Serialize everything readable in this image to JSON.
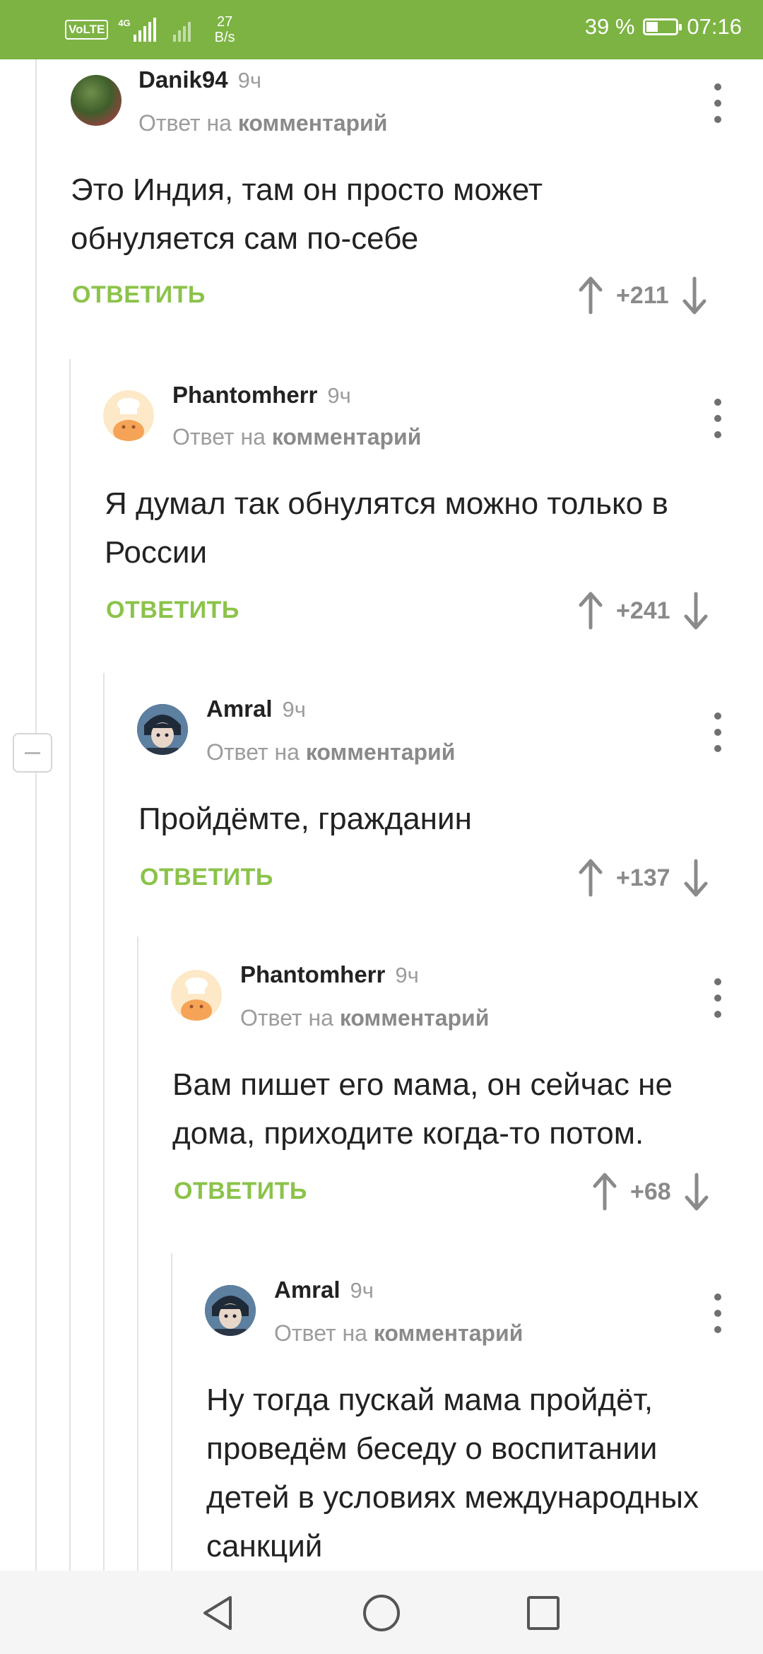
{
  "status_bar": {
    "volte": "VoLTE",
    "network_gen": "4G",
    "speed_value": "27",
    "speed_unit": "B/s",
    "battery_percent": "39 %",
    "battery_level": 0.39,
    "time": "07:16"
  },
  "labels": {
    "reply_to_prefix": "Ответ на",
    "reply_to_target": "комментарий",
    "reply_action": "ОТВЕТИТЬ"
  },
  "comments": [
    {
      "author": "Danik94",
      "time": "9ч",
      "body": "Это Индия, там он просто может обнуляется сам по-себе",
      "score": "+211"
    },
    {
      "author": "Phantomherr",
      "time": "9ч",
      "body": "Я думал так обнулятся можно только в России",
      "score": "+241"
    },
    {
      "author": "Amral",
      "time": "9ч",
      "body": "Пройдёмте, гражданин",
      "score": "+137"
    },
    {
      "author": "Phantomherr",
      "time": "9ч",
      "body": "Вам пишет его мама, он сейчас не дома, приходите когда-то потом.",
      "score": "+68"
    },
    {
      "author": "Amral",
      "time": "9ч",
      "body": "Ну тогда пускай мама пройдёт, проведём беседу о воспитании детей в условиях международных санкций",
      "score": ""
    }
  ],
  "colors": {
    "accent": "#7cb342",
    "reply_green": "#8bc34a",
    "muted_text": "#9c9c9c"
  }
}
